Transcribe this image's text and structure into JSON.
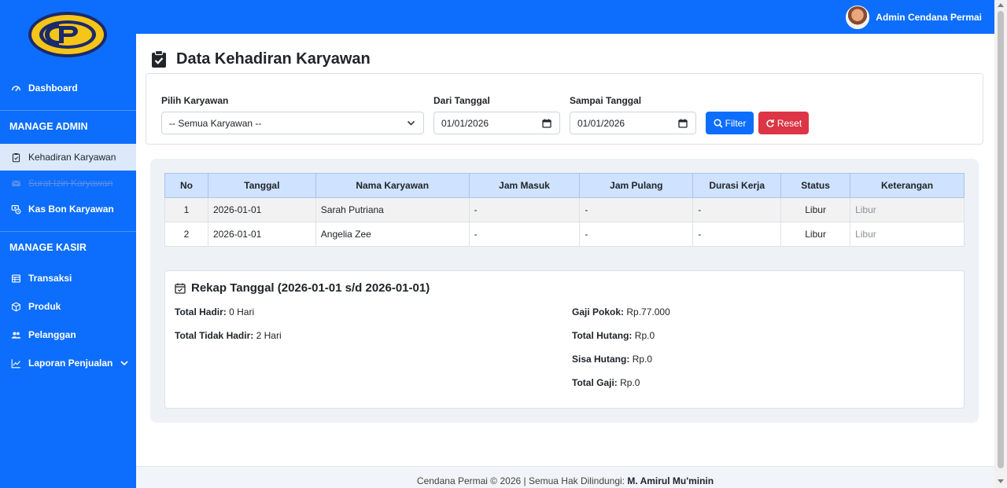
{
  "brand": {
    "logo_letters": "CP"
  },
  "user": {
    "name": "Admin Cendana Permai"
  },
  "sidebar": {
    "dashboard": "Dashboard",
    "section_admin": "MANAGE ADMIN",
    "kehadiran": "Kehadiran Karyawan",
    "surat_izin": "Surat Izin Karyawan",
    "kas_bon": "Kas Bon Karyawan",
    "section_kasir": "MANAGE KASIR",
    "transaksi": "Transaksi",
    "produk": "Produk",
    "pelanggan": "Pelanggan",
    "laporan": "Laporan Penjualan"
  },
  "page": {
    "title": "Data Kehadiran Karyawan"
  },
  "filter": {
    "employee_label": "Pilih Karyawan",
    "employee_value": "-- Semua Karyawan --",
    "from_label": "Dari Tanggal",
    "from_value": "01/01/2026",
    "to_label": "Sampai Tanggal",
    "to_value": "01/01/2026",
    "filter_btn": "Filter",
    "reset_btn": "Reset"
  },
  "table": {
    "headers": [
      "No",
      "Tanggal",
      "Nama Karyawan",
      "Jam Masuk",
      "Jam Pulang",
      "Durasi Kerja",
      "Status",
      "Keterangan"
    ],
    "rows": [
      [
        "1",
        "2026-01-01",
        "Sarah Putriana",
        "-",
        "-",
        "-",
        "Libur",
        "Libur"
      ],
      [
        "2",
        "2026-01-01",
        "Angelia Zee",
        "-",
        "-",
        "-",
        "Libur",
        "Libur"
      ]
    ]
  },
  "rekap": {
    "title": "Rekap Tanggal (2026-01-01 s/d 2026-01-01)",
    "hadir_label": "Total Hadir:",
    "hadir_value": "0 Hari",
    "tidak_hadir_label": "Total Tidak Hadir:",
    "tidak_hadir_value": "2 Hari",
    "gaji_pokok_label": "Gaji Pokok:",
    "gaji_pokok_value": "Rp.77.000",
    "total_hutang_label": "Total Hutang:",
    "total_hutang_value": "Rp.0",
    "sisa_hutang_label": "Sisa Hutang:",
    "sisa_hutang_value": "Rp.0",
    "total_gaji_label": "Total Gaji:",
    "total_gaji_value": "Rp.0"
  },
  "footer": {
    "text": "Cendana Permai © 2026 | Semua Hak Dilindungi:",
    "author": "M. Amirul Mu'minin"
  },
  "colors": {
    "primary": "#0d6efd",
    "danger": "#dc3545",
    "logo_yellow": "#f5c518",
    "logo_navy": "#1b2a6b"
  }
}
